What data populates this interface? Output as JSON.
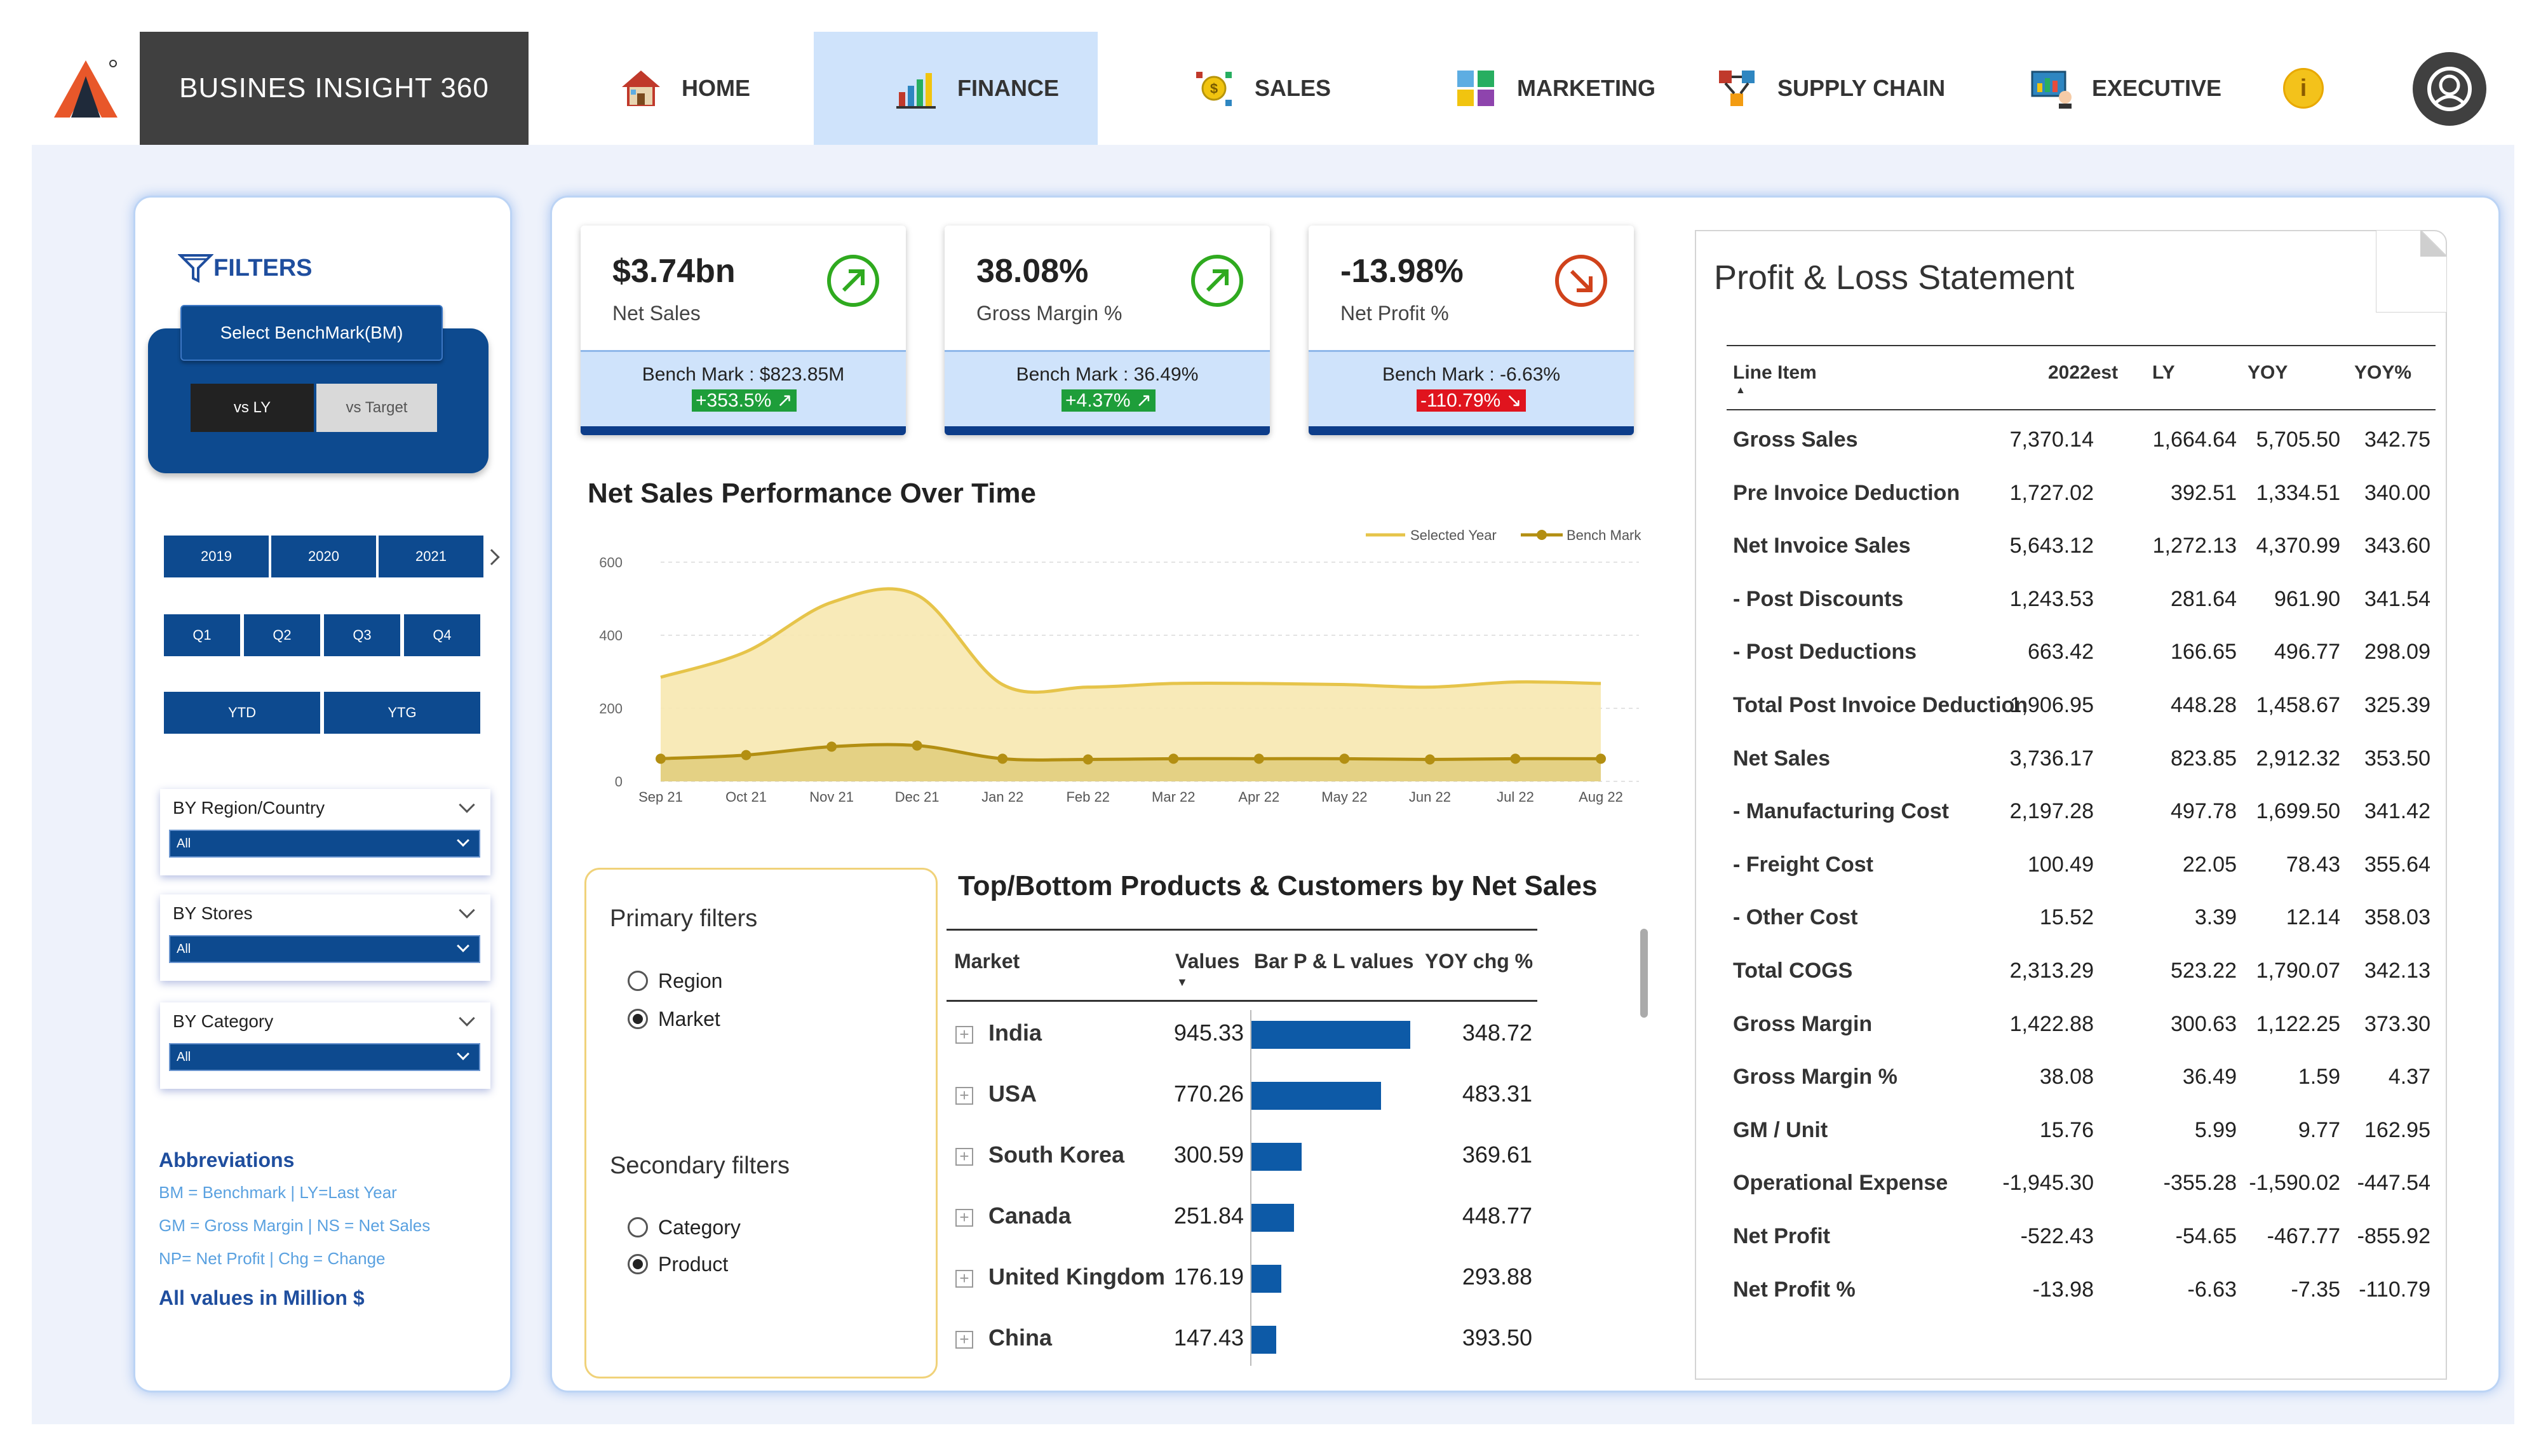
{
  "nav": {
    "brand": "BUSINES INSIGHT 360",
    "items": [
      {
        "label": "HOME",
        "icon": "home-icon"
      },
      {
        "label": "FINANCE",
        "icon": "finance-icon",
        "active": true
      },
      {
        "label": "SALES",
        "icon": "sales-icon"
      },
      {
        "label": "MARKETING",
        "icon": "marketing-icon"
      },
      {
        "label": "SUPPLY CHAIN",
        "icon": "supply-chain-icon"
      },
      {
        "label": "EXECUTIVE",
        "icon": "executive-icon"
      }
    ],
    "info": "i"
  },
  "filters": {
    "title": "FILTERS",
    "benchmark_label": "Select BenchMark(BM)",
    "vs_ly": "vs LY",
    "vs_target": "vs Target",
    "years": [
      "2019",
      "2020",
      "2021"
    ],
    "quarters": [
      "Q1",
      "Q2",
      "Q3",
      "Q4"
    ],
    "periods": [
      "YTD",
      "YTG"
    ],
    "dropdowns": [
      {
        "label": "BY Region/Country",
        "value": "All"
      },
      {
        "label": "BY Stores",
        "value": "All"
      },
      {
        "label": "BY Category",
        "value": "All"
      }
    ],
    "abbreviations_title": "Abbreviations",
    "abbreviations": [
      "BM = Benchmark | LY=Last Year",
      "GM = Gross Margin | NS = Net Sales",
      "NP= Net Profit | Chg = Change"
    ],
    "units_note": "All values in Million $"
  },
  "kpis": [
    {
      "value": "$3.74bn",
      "label": "Net Sales",
      "benchmark": "Bench Mark : $823.85M",
      "change": "+353.5%",
      "trend": "up",
      "color": "#1e9e3a"
    },
    {
      "value": "38.08%",
      "label": "Gross Margin %",
      "benchmark": "Bench Mark : 36.49%",
      "change": "+4.37%",
      "trend": "up",
      "color": "#1e9e3a"
    },
    {
      "value": "-13.98%",
      "label": "Net Profit %",
      "benchmark": "Bench Mark : -6.63%",
      "change": "-110.79%",
      "trend": "down",
      "color": "#e0141e"
    }
  ],
  "chart_title": "Net Sales Performance Over Time",
  "chart_data": {
    "type": "area",
    "categories": [
      "Sep 21",
      "Oct 21",
      "Nov 21",
      "Dec 21",
      "Jan 22",
      "Feb 22",
      "Mar 22",
      "Apr 22",
      "May 22",
      "Jun 22",
      "Jul 22",
      "Aug 22"
    ],
    "series": [
      {
        "name": "Selected Year",
        "values": [
          285,
          355,
          490,
          510,
          265,
          258,
          268,
          268,
          265,
          258,
          272,
          268
        ],
        "color": "#e6c44a"
      },
      {
        "name": "Bench Mark",
        "values": [
          62,
          72,
          95,
          98,
          62,
          60,
          62,
          62,
          62,
          60,
          62,
          62
        ],
        "color": "#b38f12"
      }
    ],
    "yticks": [
      0,
      200,
      400,
      600
    ],
    "ylim": [
      0,
      600
    ],
    "legend": "top-right",
    "grid": true
  },
  "filters2": {
    "primary_title": "Primary filters",
    "primary_options": [
      {
        "label": "Region",
        "selected": false
      },
      {
        "label": "Market",
        "selected": true
      }
    ],
    "secondary_title": "Secondary filters",
    "secondary_options": [
      {
        "label": "Category",
        "selected": false
      },
      {
        "label": "Product",
        "selected": true
      }
    ]
  },
  "topbottom": {
    "title": "Top/Bottom Products & Customers by Net Sales",
    "headers": [
      "Market",
      "Values",
      "Bar P & L values",
      "YOY chg %"
    ],
    "rows": [
      {
        "market": "India",
        "value": "945.33",
        "bar": 945.33,
        "yoy": "348.72"
      },
      {
        "market": "USA",
        "value": "770.26",
        "bar": 770.26,
        "yoy": "483.31"
      },
      {
        "market": "South Korea",
        "value": "300.59",
        "bar": 300.59,
        "yoy": "369.61"
      },
      {
        "market": "Canada",
        "value": "251.84",
        "bar": 251.84,
        "yoy": "448.77"
      },
      {
        "market": "United Kingdom",
        "value": "176.19",
        "bar": 176.19,
        "yoy": "293.88"
      },
      {
        "market": "China",
        "value": "147.43",
        "bar": 147.43,
        "yoy": "393.50"
      }
    ]
  },
  "pl": {
    "title": "Profit & Loss Statement",
    "headers": [
      "Line Item",
      "2022est",
      "LY",
      "YOY",
      "YOY%"
    ],
    "rows": [
      [
        "Gross Sales",
        "7,370.14",
        "1,664.64",
        "5,705.50",
        "342.75"
      ],
      [
        "Pre Invoice Deduction",
        "1,727.02",
        "392.51",
        "1,334.51",
        "340.00"
      ],
      [
        "Net Invoice Sales",
        "5,643.12",
        "1,272.13",
        "4,370.99",
        "343.60"
      ],
      [
        "- Post Discounts",
        "1,243.53",
        "281.64",
        "961.90",
        "341.54"
      ],
      [
        "- Post Deductions",
        "663.42",
        "166.65",
        "496.77",
        "298.09"
      ],
      [
        "Total Post Invoice Deduction",
        "1,906.95",
        "448.28",
        "1,458.67",
        "325.39"
      ],
      [
        "Net Sales",
        "3,736.17",
        "823.85",
        "2,912.32",
        "353.50"
      ],
      [
        "- Manufacturing Cost",
        "2,197.28",
        "497.78",
        "1,699.50",
        "341.42"
      ],
      [
        "- Freight Cost",
        "100.49",
        "22.05",
        "78.43",
        "355.64"
      ],
      [
        "- Other Cost",
        "15.52",
        "3.39",
        "12.14",
        "358.03"
      ],
      [
        "Total COGS",
        "2,313.29",
        "523.22",
        "1,790.07",
        "342.13"
      ],
      [
        "Gross Margin",
        "1,422.88",
        "300.63",
        "1,122.25",
        "373.30"
      ],
      [
        "Gross Margin %",
        "38.08",
        "36.49",
        "1.59",
        "4.37"
      ],
      [
        "GM / Unit",
        "15.76",
        "5.99",
        "9.77",
        "162.95"
      ],
      [
        "Operational Expense",
        "-1,945.30",
        "-355.28",
        "-1,590.02",
        "-447.54"
      ],
      [
        "Net Profit",
        "-522.43",
        "-54.65",
        "-467.77",
        "-855.92"
      ],
      [
        "Net Profit %",
        "-13.98",
        "-6.63",
        "-7.35",
        "-110.79"
      ]
    ]
  }
}
